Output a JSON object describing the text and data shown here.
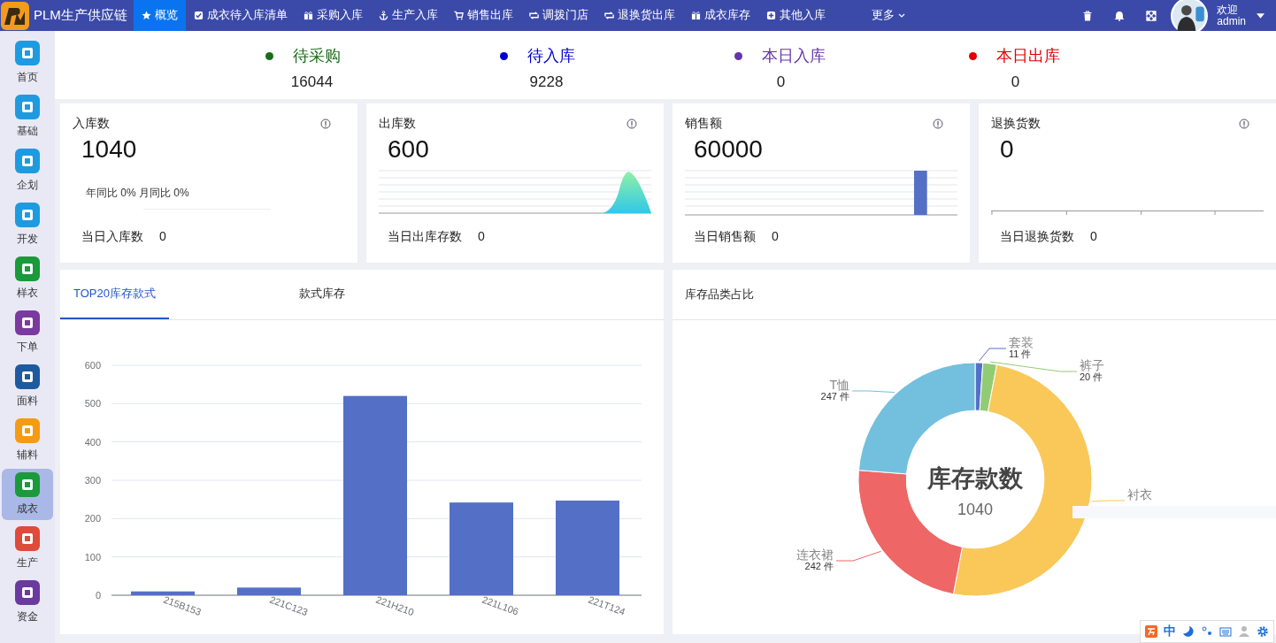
{
  "app": {
    "title": "PLM生产供应链"
  },
  "nav": [
    {
      "label": "概览",
      "selected": true
    },
    {
      "label": "成衣待入库清单",
      "selected": false
    },
    {
      "label": "采购入库",
      "selected": false
    },
    {
      "label": "生产入库",
      "selected": false
    },
    {
      "label": "销售出库",
      "selected": false
    },
    {
      "label": "调拨门店",
      "selected": false
    },
    {
      "label": "退换货出库",
      "selected": false
    },
    {
      "label": "成衣库存",
      "selected": false
    },
    {
      "label": "其他入库",
      "selected": false
    }
  ],
  "more_menu": {
    "label": "更多"
  },
  "user": {
    "greeting": "欢迎",
    "name": "admin"
  },
  "sidebar": {
    "items": [
      {
        "label": "首页",
        "color": "#1e9be0",
        "selected": false
      },
      {
        "label": "基础",
        "color": "#1e9be0",
        "selected": false
      },
      {
        "label": "企划",
        "color": "#1e9be0",
        "selected": false
      },
      {
        "label": "开发",
        "color": "#1e9be0",
        "selected": false
      },
      {
        "label": "样衣",
        "color": "#1a9a3a",
        "selected": false
      },
      {
        "label": "下单",
        "color": "#7a3aa0",
        "selected": false
      },
      {
        "label": "面料",
        "color": "#1e5aa0",
        "selected": false
      },
      {
        "label": "辅料",
        "color": "#f39c12",
        "selected": false
      },
      {
        "label": "成衣",
        "color": "#1a9a3a",
        "selected": true
      },
      {
        "label": "生产",
        "color": "#e04a3a",
        "selected": false
      },
      {
        "label": "资金",
        "color": "#6a3aa0",
        "selected": false
      }
    ]
  },
  "summary": [
    {
      "label": "待采购",
      "value": "16044",
      "color": "#1a6b1a"
    },
    {
      "label": "待入库",
      "value": "9228",
      "color": "#0000cc"
    },
    {
      "label": "本日入库",
      "value": "0",
      "color": "#6633aa"
    },
    {
      "label": "本日出库",
      "value": "0",
      "color": "#e00000"
    }
  ],
  "cards": [
    {
      "title": "入库数",
      "value": "1040",
      "kind": "compare",
      "note": "年同比 0% 月同比 0%",
      "footer_label": "当日入库数",
      "footer_value": "0"
    },
    {
      "title": "出库数",
      "value": "600",
      "kind": "area",
      "footer_label": "当日出库存数",
      "footer_value": "0"
    },
    {
      "title": "销售额",
      "value": "60000",
      "kind": "bar",
      "footer_label": "当日销售额",
      "footer_value": "0"
    },
    {
      "title": "退换货数",
      "value": "0",
      "kind": "axis",
      "footer_label": "当日退换货数",
      "footer_value": "0"
    }
  ],
  "left_panel": {
    "tabs": [
      {
        "label": "TOP20库存款式",
        "selected": true
      },
      {
        "label": "款式库存",
        "selected": false
      }
    ],
    "chart_data": {
      "type": "bar",
      "grid": true,
      "categories": [
        "215B153",
        "221C123",
        "221H210",
        "221L106",
        "221T124"
      ],
      "values": [
        10,
        20,
        520,
        242,
        247
      ],
      "ylim": [
        0,
        600
      ],
      "yticks": [
        0,
        100,
        200,
        300,
        400,
        500,
        600
      ]
    }
  },
  "right_panel": {
    "title": "库存品类占比",
    "center_title": "库存款数",
    "center_value": "1040",
    "chart_data": {
      "type": "donut",
      "categories": [
        "套装",
        "裤子",
        "衬衣",
        "连衣裙",
        "T恤"
      ],
      "values": [
        11,
        20,
        520,
        242,
        247
      ],
      "value_labels": [
        "11 件",
        "20 件",
        null,
        "242 件",
        "247 件"
      ],
      "colors": [
        "#5470c6",
        "#91cc75",
        "#fac858",
        "#ee6666",
        "#73c0de"
      ]
    }
  },
  "ime_toolbar": {
    "label": "中"
  }
}
